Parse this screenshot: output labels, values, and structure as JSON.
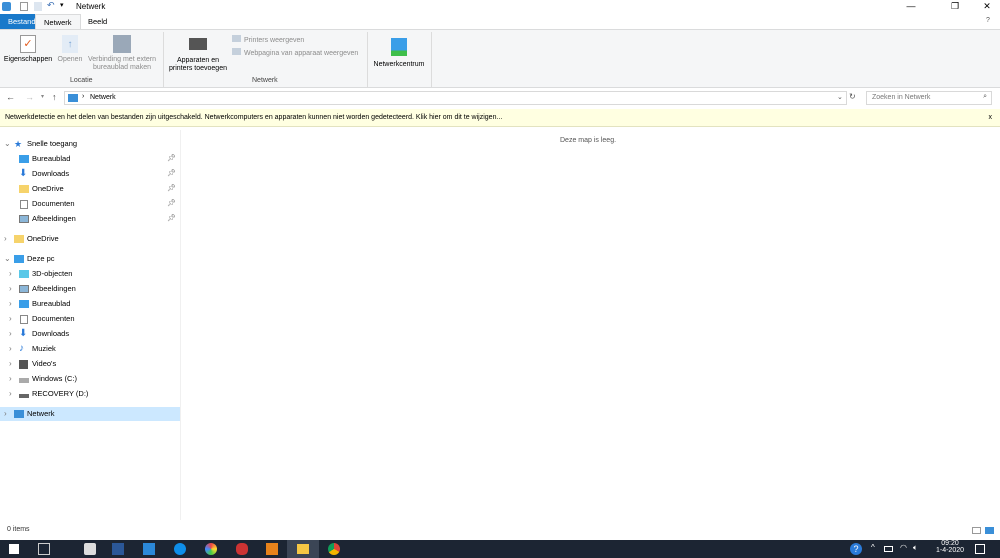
{
  "window": {
    "title": "Netwerk"
  },
  "tabs": [
    {
      "label": "Bestand"
    },
    {
      "label": "Netwerk"
    },
    {
      "label": "Beeld"
    }
  ],
  "ribbon": {
    "properties": "Eigenschappen",
    "open": "Openen",
    "remote1": "Verbinding met extern",
    "remote2": "bureaublad maken",
    "group_location": "Locatie",
    "add1": "Apparaten en",
    "add2": "printers toevoegen",
    "show_printers": "Printers weergeven",
    "device_page": "Webpagina van apparaat weergeven",
    "group_network": "Netwerk",
    "network_center": "Netwerkcentrum"
  },
  "address": {
    "path": "Netwerk",
    "search_placeholder": "Zoeken in Netwerk"
  },
  "info_bar": {
    "text": "Netwerkdetectie en het delen van bestanden zijn uitgeschakeld. Netwerkcomputers en apparaten kunnen niet worden gedetecteerd. Klik hier om dit te wijzigen...",
    "close": "x"
  },
  "nav": {
    "quick_access": "Snelle toegang",
    "quick_items": [
      {
        "label": "Bureaublad"
      },
      {
        "label": "Downloads"
      },
      {
        "label": "OneDrive"
      },
      {
        "label": "Documenten"
      },
      {
        "label": "Afbeeldingen"
      }
    ],
    "onedrive": "OneDrive",
    "this_pc": "Deze pc",
    "pc_items": [
      {
        "label": "3D-objecten"
      },
      {
        "label": "Afbeeldingen"
      },
      {
        "label": "Bureaublad"
      },
      {
        "label": "Documenten"
      },
      {
        "label": "Downloads"
      },
      {
        "label": "Muziek"
      },
      {
        "label": "Video's"
      },
      {
        "label": "Windows (C:)"
      },
      {
        "label": "RECOVERY (D:)"
      }
    ],
    "network": "Netwerk"
  },
  "content": {
    "empty": "Deze map is leeg."
  },
  "status": {
    "items": "0 items"
  },
  "taskbar": {
    "time": "09:20",
    "date": "1-4-2020"
  }
}
